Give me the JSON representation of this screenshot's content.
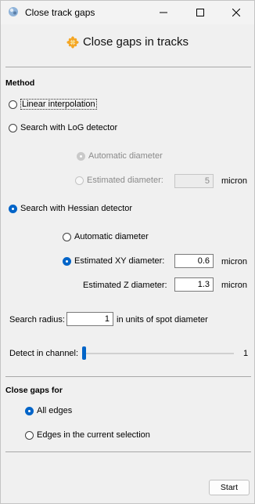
{
  "window": {
    "title": "Close track gaps"
  },
  "header": {
    "title": "Close gaps in tracks"
  },
  "method": {
    "section_label": "Method",
    "linear": "Linear interpolation",
    "log": {
      "label": "Search with LoG detector",
      "auto": "Automatic diameter",
      "estimated": "Estimated diameter:",
      "estimated_value": "5",
      "unit": "micron"
    },
    "hessian": {
      "label": "Search with Hessian detector",
      "auto": "Automatic diameter",
      "xy_label": "Estimated XY diameter:",
      "xy_value": "0.6",
      "z_label": "Estimated Z diameter:",
      "z_value": "1.3",
      "unit": "micron"
    }
  },
  "search_radius": {
    "label": "Search radius:",
    "value": "1",
    "suffix": "in units of spot diameter"
  },
  "channel": {
    "label": "Detect in channel:",
    "value": "1",
    "level": 0.0
  },
  "close_gaps": {
    "section_label": "Close gaps for",
    "all_edges": "All edges",
    "selection": "Edges in the current selection"
  },
  "actions": {
    "start": "Start"
  },
  "colors": {
    "accent": "#0064c8"
  }
}
